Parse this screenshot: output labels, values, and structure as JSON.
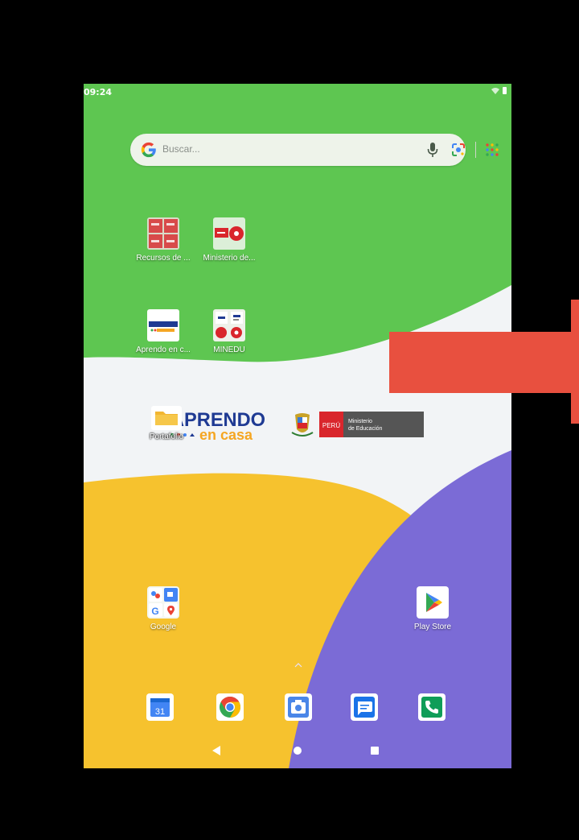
{
  "status_bar": {
    "time": "09:24",
    "wifi_icon": "wifi-icon",
    "battery_icon": "battery-icon"
  },
  "search": {
    "placeholder": "Buscar...",
    "logo_icon": "google-g-icon",
    "mic_icon": "mic-icon",
    "lens_icon": "lens-icon",
    "apps_icon": "apps-grid-icon"
  },
  "apps": [
    {
      "label": "Recursos de ...",
      "icon": "recursos-pdf-icon"
    },
    {
      "label": "Ministerio de...",
      "icon": "ministerio-icon"
    },
    {
      "label": "Aprendo en c...",
      "icon": "aprendo-en-casa-icon"
    },
    {
      "label": "MINEDU",
      "icon": "minedu-icon"
    }
  ],
  "widgets": {
    "aprendo_line1": "APRENDO",
    "aprendo_line2": "en casa",
    "peru_text": "PERÚ",
    "ministerio_line1": "Ministerio",
    "ministerio_line2": "de Educación"
  },
  "portafolio": {
    "label": "Portafolio",
    "icon": "folder-icon"
  },
  "google_folder": {
    "label": "Google",
    "icon": "google-folder-icon"
  },
  "play_store": {
    "label": "Play Store",
    "icon": "play-store-icon"
  },
  "dock": [
    {
      "name": "calendar",
      "icon": "calendar-icon",
      "text": "31"
    },
    {
      "name": "chrome",
      "icon": "chrome-icon"
    },
    {
      "name": "camera",
      "icon": "camera-icon"
    },
    {
      "name": "messages",
      "icon": "messages-icon"
    },
    {
      "name": "phone",
      "icon": "phone-icon"
    }
  ],
  "navigation": {
    "back_icon": "back-icon",
    "home_icon": "home-icon",
    "recents_icon": "recents-icon"
  },
  "colors": {
    "wallpaper_green": "#5ec651",
    "wallpaper_yellow": "#f6c22e",
    "wallpaper_purple": "#7b6bd6",
    "arrow_red": "#e8503f"
  }
}
